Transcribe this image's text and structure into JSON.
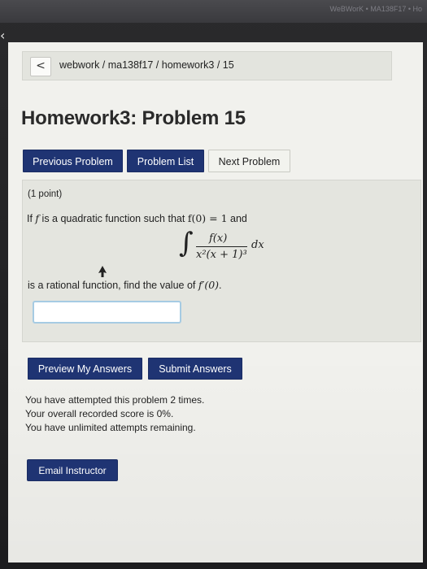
{
  "topbar": {
    "text": "WeBWorK • MA138F17 • Ho"
  },
  "breadcrumb": {
    "back_glyph": "<",
    "path": "webwork / ma138f17 / homework3 / 15"
  },
  "page_title": "Homework3: Problem 15",
  "nav": {
    "previous": "Previous Problem",
    "list": "Problem List",
    "next": "Next Problem"
  },
  "problem": {
    "points": "(1 point)",
    "line1_pre": "If ",
    "line1_f": "f",
    "line1_mid": " is a quadratic function such that ",
    "line1_eq": "f(0) = 1",
    "line1_post": " and",
    "integral_num": "f(x)",
    "integral_den": "x²(x + 1)³",
    "integral_dx": "dx",
    "line2_pre": "is a rational function, find the value of ",
    "line2_eq": "f′(0)",
    "line2_post": "."
  },
  "answer": {
    "value": ""
  },
  "actions": {
    "preview": "Preview My Answers",
    "submit": "Submit Answers"
  },
  "status": {
    "attempts": "You have attempted this problem 2 times.",
    "score": "Your overall recorded score is 0%.",
    "remaining": "You have unlimited attempts remaining."
  },
  "email_button": "Email Instructor",
  "colors": {
    "primary_button": "#1f3473",
    "page_background": "#f1f1ed",
    "panel_background": "#e4e5df",
    "input_border": "#a6cbe3"
  }
}
